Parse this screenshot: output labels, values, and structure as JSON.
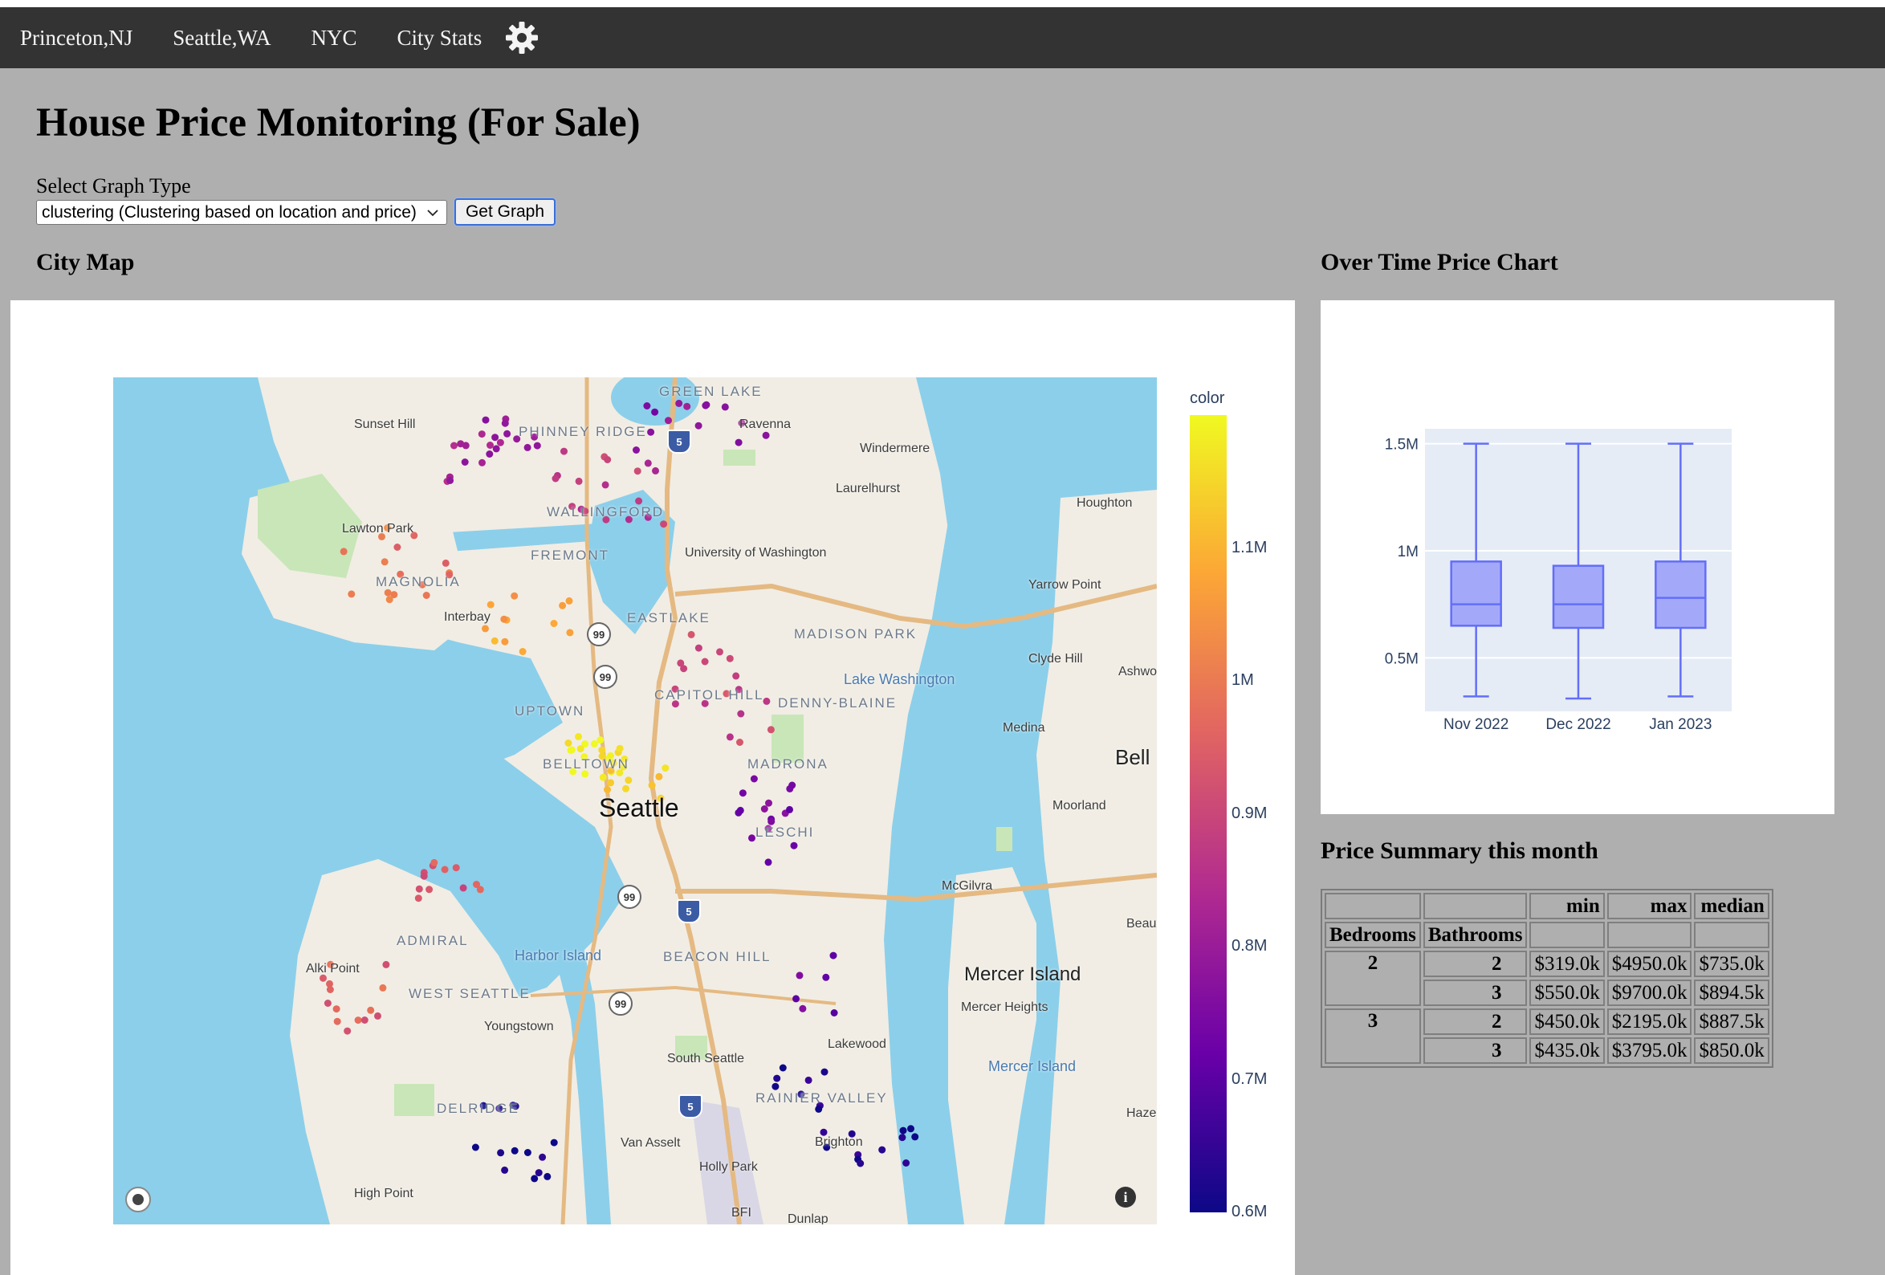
{
  "nav": {
    "links": [
      "Princeton,NJ",
      "Seattle,WA",
      "NYC",
      "City Stats"
    ],
    "settings_icon": "gear-icon"
  },
  "page": {
    "title": "House Price Monitoring (For Sale)",
    "select_label": "Select Graph Type",
    "select_value": "clustering (Clustering based on location and price)",
    "button_label": "Get Graph"
  },
  "sections": {
    "map_title": "City Map",
    "chart_title": "Over Time Price Chart",
    "summary_title": "Price Summary this month"
  },
  "map": {
    "colorbar_title": "color",
    "colorbar_ticks": [
      "1.1M",
      "1M",
      "0.9M",
      "0.8M",
      "0.7M",
      "0.6M"
    ],
    "colorscale": [
      "#0d0887",
      "#6a00a8",
      "#b12a90",
      "#e16462",
      "#fca636",
      "#f0f921"
    ],
    "place_labels": [
      "GREEN LAKE",
      "Ravenna",
      "Sunset Hill",
      "PHINNEY RIDGE",
      "Windermere",
      "Laurelhurst",
      "Houghton",
      "WALLINGFORD",
      "Lawton Park",
      "FREMONT",
      "University of Washington",
      "MAGNOLIA",
      "Yarrow Point",
      "Interbay",
      "EASTLAKE",
      "MADISON PARK",
      "Lake Washington",
      "Clyde Hill",
      "Ashwo",
      "CAPITOL HILL",
      "DENNY-BLAINE",
      "UPTOWN",
      "Medina",
      "BELLTOWN",
      "MADRONA",
      "Bell",
      "Seattle",
      "Moorland",
      "LESCHI",
      "McGilvra",
      "ADMIRAL",
      "Harbor Island",
      "Beaux Ar Village",
      "Alki Point",
      "BEACON HILL",
      "Mercer Island",
      "WEST SEATTLE",
      "Mercer Heights",
      "Youngstown",
      "Lakewood",
      "South Seattle",
      "Mercer Island",
      "DELRIDGE",
      "RAINIER VALLEY",
      "Haze",
      "Van Asselt",
      "Brighton",
      "Holly Park",
      "High Point",
      "BFI",
      "Dunlap"
    ],
    "highway_shields": [
      "5",
      "99",
      "99",
      "99",
      "5",
      "99",
      "5"
    ],
    "map_icons": [
      "compass-icon",
      "info-icon"
    ]
  },
  "chart_data": {
    "type": "box",
    "categories": [
      "Nov 2022",
      "Dec 2022",
      "Jan 2023"
    ],
    "boxes": [
      {
        "min": 0.32,
        "q1": 0.65,
        "median": 0.75,
        "q3": 0.95,
        "max": 1.5
      },
      {
        "min": 0.31,
        "q1": 0.64,
        "median": 0.75,
        "q3": 0.93,
        "max": 1.5
      },
      {
        "min": 0.32,
        "q1": 0.64,
        "median": 0.78,
        "q3": 0.95,
        "max": 1.5
      }
    ],
    "y_ticks": [
      "0.5M",
      "1M",
      "1.5M"
    ],
    "ylim": [
      0.25,
      1.57
    ],
    "color": "#636efa"
  },
  "summary_table": {
    "top_headers": [
      "",
      "",
      "min",
      "max",
      "median"
    ],
    "index_headers": [
      "Bedrooms",
      "Bathrooms"
    ],
    "rows": [
      {
        "bedrooms": "2",
        "bathrooms": "2",
        "min": "$319.0k",
        "max": "$4950.0k",
        "median": "$735.0k"
      },
      {
        "bedrooms": "",
        "bathrooms": "3",
        "min": "$550.0k",
        "max": "$9700.0k",
        "median": "$894.5k"
      },
      {
        "bedrooms": "3",
        "bathrooms": "2",
        "min": "$450.0k",
        "max": "$2195.0k",
        "median": "$887.5k"
      },
      {
        "bedrooms": "",
        "bathrooms": "3",
        "min": "$435.0k",
        "max": "$3795.0k",
        "median": "$850.0k"
      }
    ]
  }
}
